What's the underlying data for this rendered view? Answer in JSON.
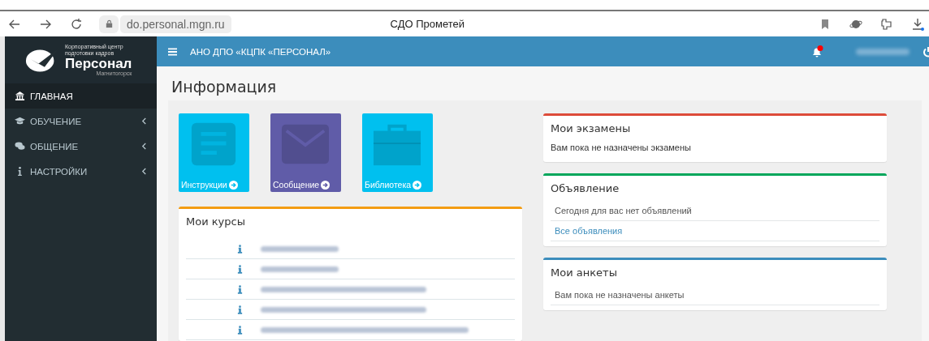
{
  "browser": {
    "url": "do.personal.mgn.ru",
    "title": "СДО Прометей"
  },
  "logo": {
    "caption": "Корпоративный центр подготовки кадров",
    "name": "Персонал",
    "city": "Магнитогорск"
  },
  "header": {
    "org": "АНО ДПО «КЦПК «ПЕРСОНАЛ»",
    "notification": true
  },
  "sidebar": {
    "items": [
      {
        "label": "ГЛАВНАЯ",
        "selected": true,
        "expandable": false
      },
      {
        "label": "ОБУЧЕНИЕ",
        "selected": false,
        "expandable": true
      },
      {
        "label": "ОБЩЕНИЕ",
        "selected": false,
        "expandable": true
      },
      {
        "label": "НАСТРОЙКИ",
        "selected": false,
        "expandable": true
      }
    ]
  },
  "page_title": "Информация",
  "tiles": [
    {
      "label": "Инструкции",
      "color": "#00c0ef"
    },
    {
      "label": "Сообщение",
      "color": "#605ca8"
    },
    {
      "label": "Библиотека",
      "color": "#00c0ef"
    }
  ],
  "courses": {
    "title": "Мои курсы",
    "color": "#f39c12",
    "rows": [
      {
        "kind": "blurred"
      },
      {
        "kind": "blurred"
      },
      {
        "kind": "blurred"
      },
      {
        "kind": "blurred"
      },
      {
        "kind": "blurred"
      }
    ]
  },
  "panels": [
    {
      "title": "Мои экзамены",
      "color": "#dd4b39",
      "items": [
        {
          "kind": "plain",
          "text": "Вам пока не назначены экзамены"
        }
      ]
    },
    {
      "title": "Объявление",
      "color": "#00a65a",
      "items": [
        {
          "kind": "row",
          "text": "Сегодня для вас нет объявлений"
        },
        {
          "kind": "link",
          "text": "Все объявления"
        }
      ]
    },
    {
      "title": "Мои анкеты",
      "color": "#3c8dbc",
      "items": [
        {
          "kind": "row",
          "text": "Вам пока не назначены анкеты"
        }
      ]
    }
  ]
}
